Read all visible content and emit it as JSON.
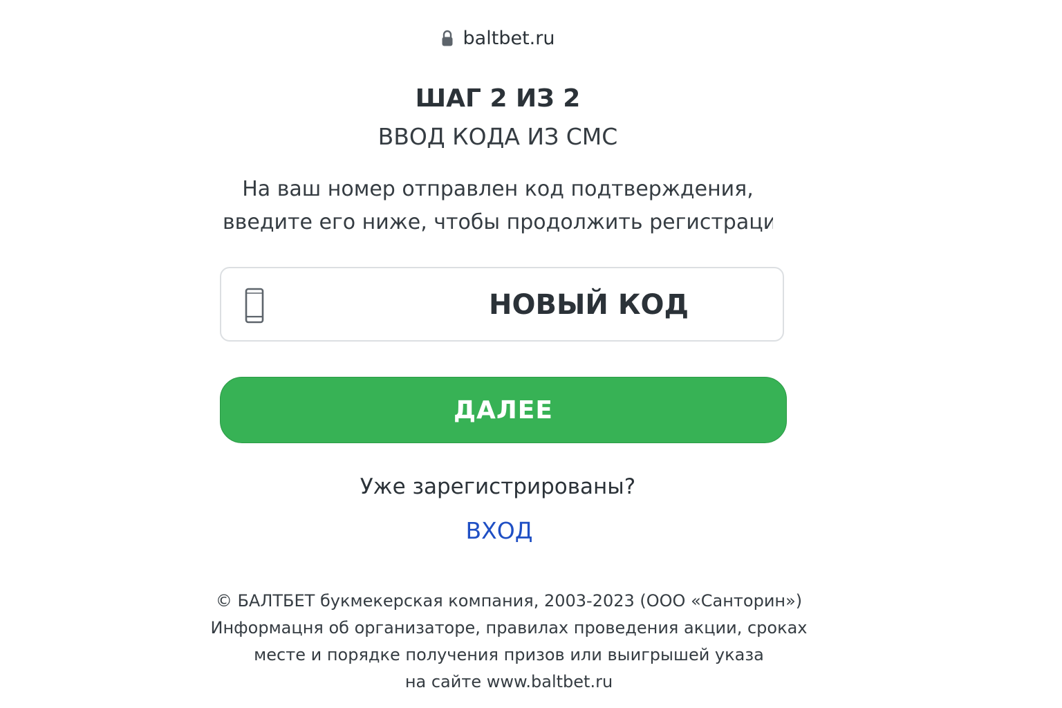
{
  "browser": {
    "url": "baltbet.ru"
  },
  "step": {
    "title": "ШАГ 2 ИЗ 2",
    "subtitle": "ВВОД КОДА ИЗ СМС"
  },
  "description": {
    "line1": "На ваш номер отправлен код подтверждения,",
    "line2": "введите его ниже, чтобы продолжить регистрацию"
  },
  "code_field": {
    "value": "НОВЫЙ КОД"
  },
  "next_button": {
    "label": "ДАЛЕЕ"
  },
  "login": {
    "prompt": "Уже зарегистрированы?",
    "link_label": "ВХОД"
  },
  "footer": {
    "line1": "© БАЛТБЕТ букмекерская компания, 2003-2023 (ООО «Санторин»)",
    "line2": "Информацня об организаторе, правилах проведения акции, сроках",
    "line3": "месте и порядке получения призов или выигрышей указа",
    "line4": "на сайте www.baltbet.ru"
  },
  "colors": {
    "accent_green": "#37b255",
    "link_blue": "#1f4fc4",
    "text_dark": "#2b3238"
  },
  "icons": {
    "url_bar": "lock-icon",
    "code_field": "phone-icon"
  }
}
